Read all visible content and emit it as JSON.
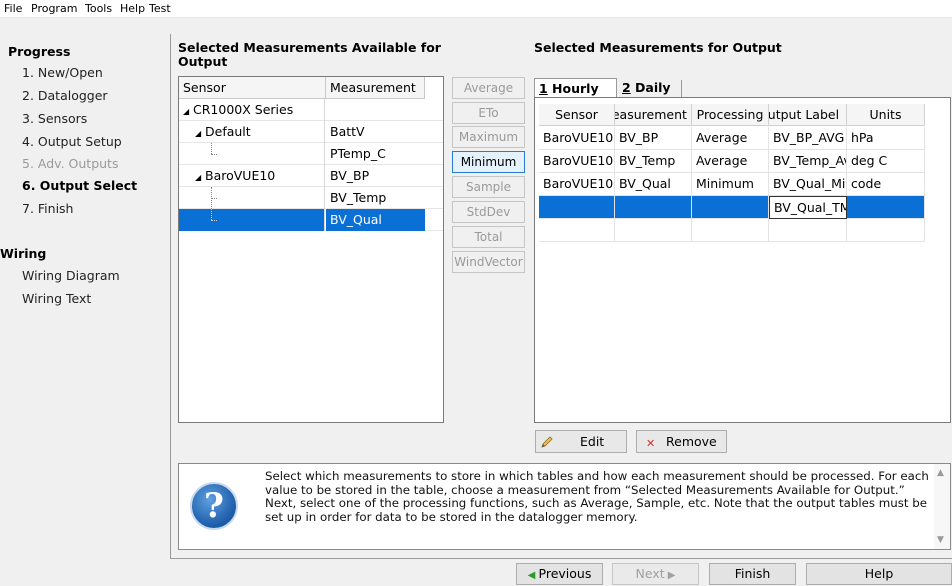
{
  "menu": [
    "File",
    "Program",
    "Tools",
    "Help",
    "Test"
  ],
  "progress": {
    "title": "Progress",
    "items": [
      {
        "label": "1. New/Open",
        "state": "normal"
      },
      {
        "label": "2. Datalogger",
        "state": "normal"
      },
      {
        "label": "3. Sensors",
        "state": "normal"
      },
      {
        "label": "4. Output Setup",
        "state": "normal"
      },
      {
        "label": "5. Adv. Outputs",
        "state": "disabled"
      },
      {
        "label": "6. Output Select",
        "state": "active"
      },
      {
        "label": "7. Finish",
        "state": "normal"
      }
    ]
  },
  "wiring": {
    "title": "Wiring",
    "items": [
      "Wiring Diagram",
      "Wiring Text"
    ]
  },
  "available": {
    "title_line1": "Selected Measurements Available for",
    "title_line2": "Output",
    "col_sensor": "Sensor",
    "col_measurement": "Measurement",
    "rows": [
      {
        "sensor": "CR1000X Series",
        "measurement": ""
      },
      {
        "sensor": "Default",
        "measurement": "BattV"
      },
      {
        "sensor": "",
        "measurement": "PTemp_C"
      },
      {
        "sensor": "BaroVUE10",
        "measurement": "BV_BP"
      },
      {
        "sensor": "",
        "measurement": "BV_Temp"
      },
      {
        "sensor": "",
        "measurement": "BV_Qual"
      }
    ]
  },
  "processing_buttons": [
    "Average",
    "ETo",
    "Maximum",
    "Minimum",
    "Sample",
    "StdDev",
    "Total",
    "WindVector"
  ],
  "output": {
    "title": "Selected Measurements for Output",
    "tabs": [
      {
        "num": "1",
        "label": " Hourly"
      },
      {
        "num": "2",
        "label": " Daily"
      }
    ],
    "columns": [
      "Sensor",
      "Measurement",
      "Processing",
      "Output Label",
      "Units"
    ],
    "rows": [
      [
        "BaroVUE10",
        "BV_BP",
        "Average",
        "BV_BP_AVG",
        "hPa"
      ],
      [
        "BaroVUE10",
        "BV_Temp",
        "Average",
        "BV_Temp_Avg",
        "deg C"
      ],
      [
        "BaroVUE10",
        "BV_Qual",
        "Minimum",
        "BV_Qual_Min",
        "code"
      ],
      [
        "",
        "",
        "",
        "BV_Qual_TMn",
        ""
      ]
    ]
  },
  "actions": {
    "edit": "Edit",
    "remove": "Remove"
  },
  "help_text": "Select which measurements to store in which tables and how each measurement should be processed. For each value to be stored in the table, choose a measurement from “Selected Measurements Available for Output.”  Next, select one of the processing functions, such as Average, Sample, etc. Note that the output tables must be set up in order for data to be stored in the datalogger memory.",
  "help_icon": "?",
  "bottom": {
    "previous": "Previous",
    "next": "Next",
    "finish": "Finish",
    "help": "Help"
  }
}
